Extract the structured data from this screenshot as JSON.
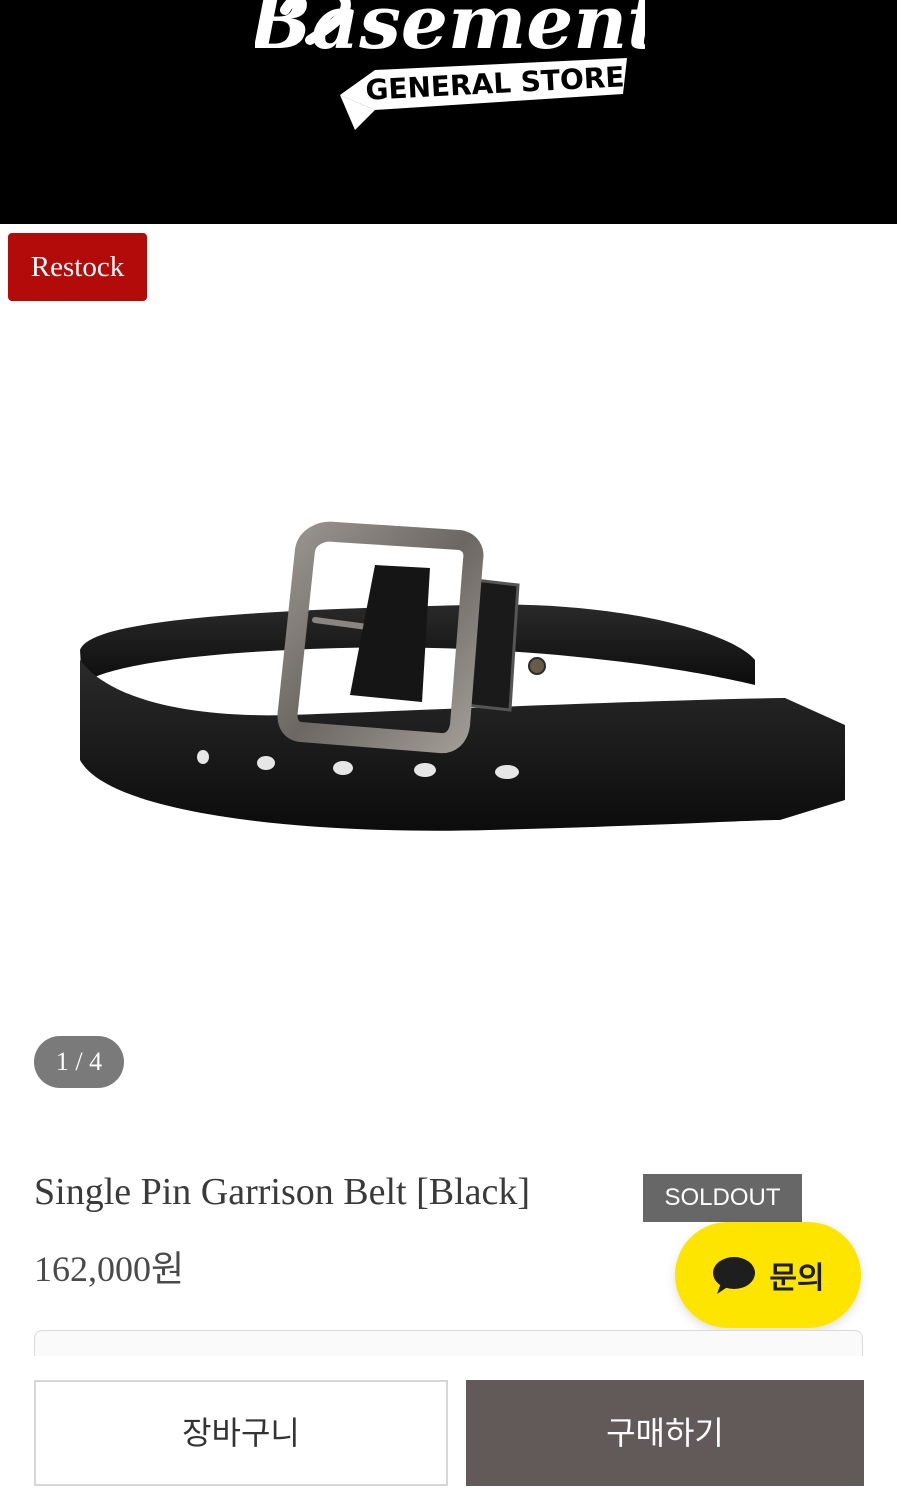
{
  "header": {
    "logo_text_main": "Basement",
    "logo_text_sub": "GENERAL STORE"
  },
  "badge": {
    "restock_label": "Restock"
  },
  "gallery": {
    "counter": "1 / 4"
  },
  "product": {
    "title": "Single Pin Garrison Belt [Black]",
    "status": "SOLDOUT",
    "price": "162,000원"
  },
  "chat": {
    "inquiry_label": "문의"
  },
  "actions": {
    "cart_label": "장바구니",
    "buy_label": "구매하기"
  },
  "colors": {
    "restock_badge": "#b30a0a",
    "soldout_badge": "#676767",
    "buy_button": "#625a58",
    "kakao_yellow": "#fee500"
  }
}
